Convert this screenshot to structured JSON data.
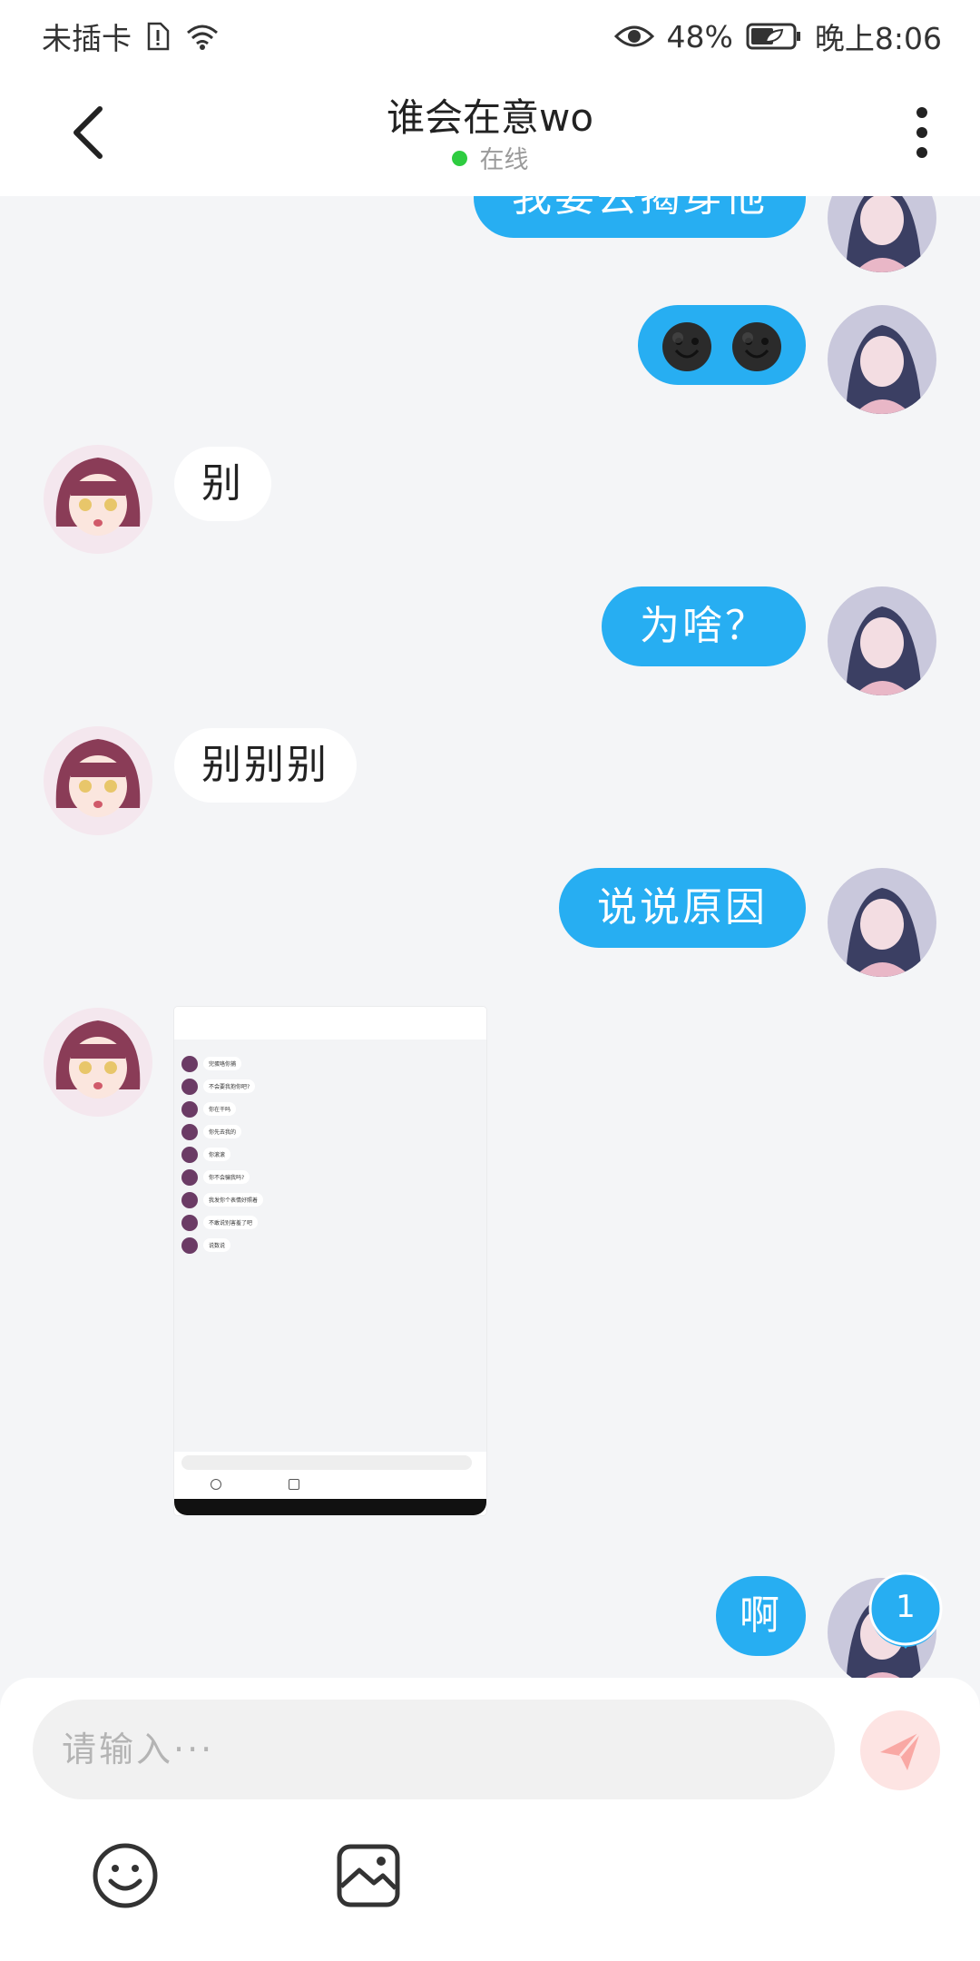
{
  "status_bar": {
    "carrier": "未插卡",
    "battery_percent": "48%",
    "time": "晚上8:06"
  },
  "header": {
    "title": "谁会在意wo",
    "status": "在线"
  },
  "messages": [
    {
      "side": "me",
      "text": "我要去揭穿他"
    },
    {
      "side": "me",
      "text": "",
      "emoji": [
        "smile-icon",
        "smile-icon"
      ]
    },
    {
      "side": "other",
      "text": "别"
    },
    {
      "side": "me",
      "text": "为啥？"
    },
    {
      "side": "other",
      "text": "别别别"
    },
    {
      "side": "me",
      "text": "说说原因"
    },
    {
      "side": "other",
      "type": "image"
    },
    {
      "side": "me",
      "text": "啊"
    }
  ],
  "screenshot_preview": {
    "items": [
      "完蛋咯你捕",
      "不会要我抱你吧?",
      "你在干吗",
      "你先去我的",
      "你滚滚",
      "你不会骗我吗?",
      "我发你个表情好照着",
      "不敢说别害羞了吧",
      "说数说"
    ]
  },
  "unread_badge": "1",
  "composer": {
    "placeholder": "请输入···"
  },
  "colors": {
    "accent": "#27aef2",
    "online": "#2ecc40",
    "send_disabled": "#fde4e3"
  }
}
